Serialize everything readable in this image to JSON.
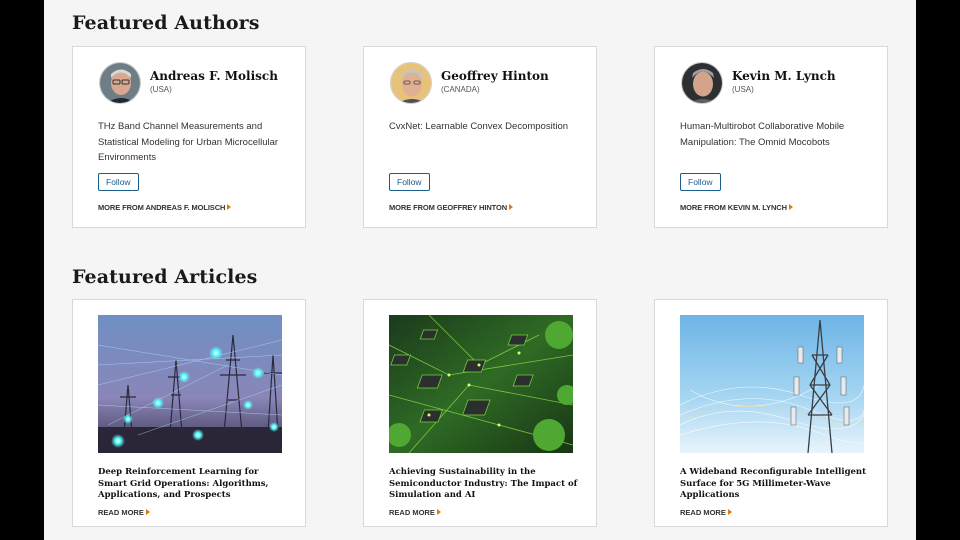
{
  "authors_section": {
    "title": "Featured Authors",
    "authors": [
      {
        "name": "Andreas F. Molisch",
        "country": "(USA)",
        "paper": "THz Band Channel Measurements and Statistical Modeling for Urban Microcellular Environments",
        "follow_label": "Follow",
        "more_label": "MORE FROM ANDREAS F. MOLISCH"
      },
      {
        "name": "Geoffrey Hinton",
        "country": "(CANADA)",
        "paper": "CvxNet: Learnable Convex Decomposition",
        "follow_label": "Follow",
        "more_label": "MORE FROM GEOFFREY HINTON"
      },
      {
        "name": "Kevin M. Lynch",
        "country": "(USA)",
        "paper": "Human-Multirobot Collaborative Mobile Manipulation: The Omnid Mocobots",
        "follow_label": "Follow",
        "more_label": "MORE FROM KEVIN M. LYNCH"
      }
    ]
  },
  "articles_section": {
    "title": "Featured Articles",
    "articles": [
      {
        "title": "Deep Reinforcement Learning for Smart Grid Operations: Algorithms, Applications, and Prospects",
        "read_more_label": "READ MORE",
        "image": "power-grid-network-image"
      },
      {
        "title": "Achieving Sustainability in the Semiconductor Industry: The Impact of Simulation and AI",
        "read_more_label": "READ MORE",
        "image": "green-circuit-board-image"
      },
      {
        "title": "A Wideband Reconfigurable Intelligent Surface for 5G Millimeter-Wave Applications",
        "read_more_label": "READ MORE",
        "image": "cell-tower-signal-image"
      }
    ]
  },
  "colors": {
    "page_background": "#f5f5f5",
    "card_border": "#d9d9d9",
    "follow_button": "#1a5e8c",
    "link_arrow": "#e07b00"
  }
}
